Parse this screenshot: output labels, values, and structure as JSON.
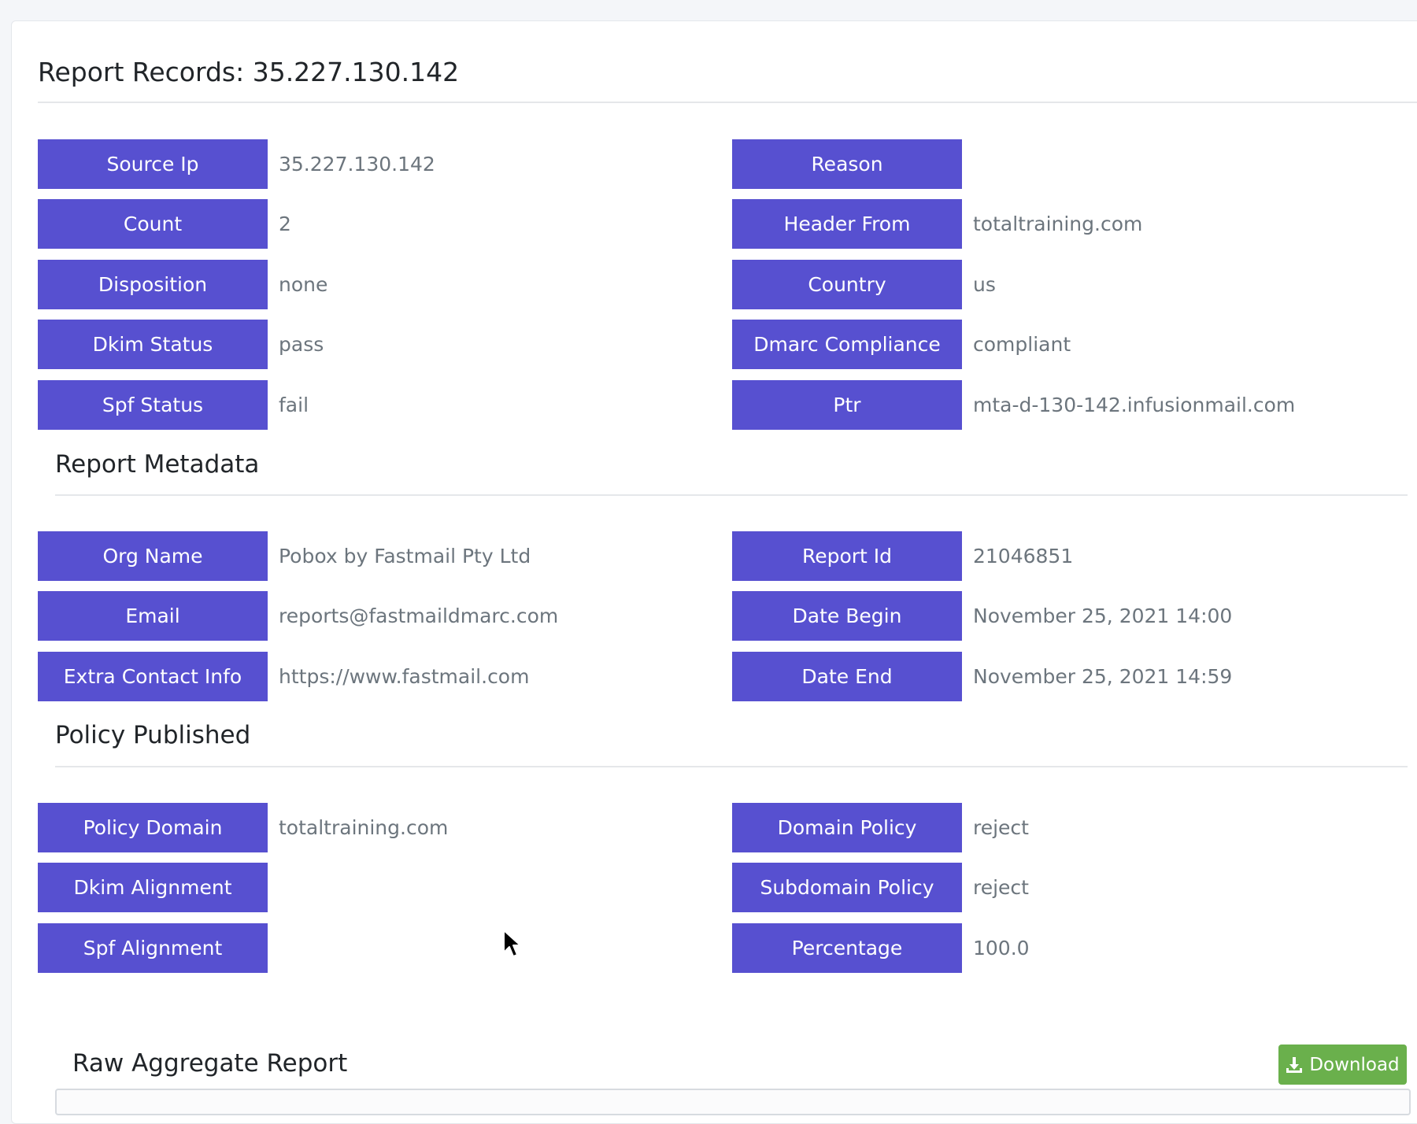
{
  "title": "Report Records: 35.227.130.142",
  "record": {
    "left": [
      {
        "label": "Source Ip",
        "value": "35.227.130.142"
      },
      {
        "label": "Count",
        "value": "2"
      },
      {
        "label": "Disposition",
        "value": "none"
      },
      {
        "label": "Dkim Status",
        "value": "pass"
      },
      {
        "label": "Spf Status",
        "value": "fail"
      }
    ],
    "right": [
      {
        "label": "Reason",
        "value": ""
      },
      {
        "label": "Header From",
        "value": "totaltraining.com"
      },
      {
        "label": "Country",
        "value": "us"
      },
      {
        "label": "Dmarc Compliance",
        "value": "compliant"
      },
      {
        "label": "Ptr",
        "value": "mta-d-130-142.infusionmail.com"
      }
    ]
  },
  "metadata": {
    "title": "Report Metadata",
    "left": [
      {
        "label": "Org Name",
        "value": "Pobox by Fastmail Pty Ltd"
      },
      {
        "label": "Email",
        "value": "reports@fastmaildmarc.com"
      },
      {
        "label": "Extra Contact Info",
        "value": "https://www.fastmail.com"
      }
    ],
    "right": [
      {
        "label": "Report Id",
        "value": "21046851"
      },
      {
        "label": "Date Begin",
        "value": "November 25, 2021 14:00"
      },
      {
        "label": "Date End",
        "value": "November 25, 2021 14:59"
      }
    ]
  },
  "policy": {
    "title": "Policy Published",
    "left": [
      {
        "label": "Policy Domain",
        "value": "totaltraining.com"
      },
      {
        "label": "Dkim Alignment",
        "value": ""
      },
      {
        "label": "Spf Alignment",
        "value": ""
      }
    ],
    "right": [
      {
        "label": "Domain Policy",
        "value": "reject"
      },
      {
        "label": "Subdomain Policy",
        "value": "reject"
      },
      {
        "label": "Percentage",
        "value": "100.0"
      }
    ]
  },
  "raw": {
    "title": "Raw Aggregate Report",
    "download_label": "Download"
  },
  "colors": {
    "label_bg": "#5750d0",
    "download_bg": "#6ab04c"
  },
  "icons": {
    "download": "download-icon",
    "cursor": "mouse-pointer-icon"
  }
}
